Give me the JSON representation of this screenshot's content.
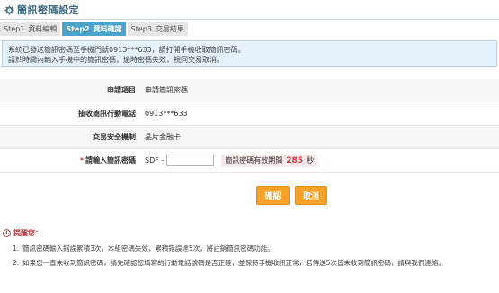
{
  "page": {
    "title": "簡訊密碼設定"
  },
  "steps": [
    {
      "num": "Step1",
      "label": "資料編輯",
      "active": false
    },
    {
      "num": "Step2",
      "label": "資料確認",
      "active": true
    },
    {
      "num": "Step3",
      "label": "交易結果",
      "active": false
    }
  ],
  "notice": {
    "line1": "系統已發送簡訊密碼至手機門號0913***633，請打開手機收取簡訊密碼。",
    "line2": "請於時間內輸入手機中的簡訊密碼，逾時密碼失效，視同交易取消。"
  },
  "form": {
    "item_label": "申請項目",
    "item_value": "申請簡訊密碼",
    "phone_label": "接收簡訊行動電話",
    "phone_value": "0913***633",
    "security_label": "交易安全機制",
    "security_value": "晶片金融卡",
    "otp_required_mark": "*",
    "otp_label": "請輸入簡訊密碼",
    "otp_prefix": "SDF -",
    "otp_value": "",
    "timer_label": "簡訊密碼有效期間",
    "timer_seconds": "285",
    "timer_unit": "秒"
  },
  "buttons": {
    "confirm": "確認",
    "cancel": "取消"
  },
  "reminder": {
    "title": "提醒您：",
    "notes": [
      {
        "index": "1.",
        "text": "簡訊密碼輸入錯誤累積3次，本組密碼失效，累積錯誤達5次，將註銷簡訊密碼功能。"
      },
      {
        "index": "2.",
        "text": "如果您一直未收到簡訊密碼，請先確認您填寫的行動電話號碼是否正確，並保持手機收訊正常，若傳送5次皆未收到簡訊密碼，請與我們連絡。"
      }
    ]
  },
  "colors": {
    "title": "#3d6e86",
    "active_step": "#4aa3c8",
    "notice_bg": "#e5f1fb",
    "button": "#f5a12a",
    "timer_seconds": "#d0393f",
    "required": "#d33a3a"
  },
  "icons": {
    "title": "gear-icon",
    "reminder": "info-circle-icon"
  }
}
